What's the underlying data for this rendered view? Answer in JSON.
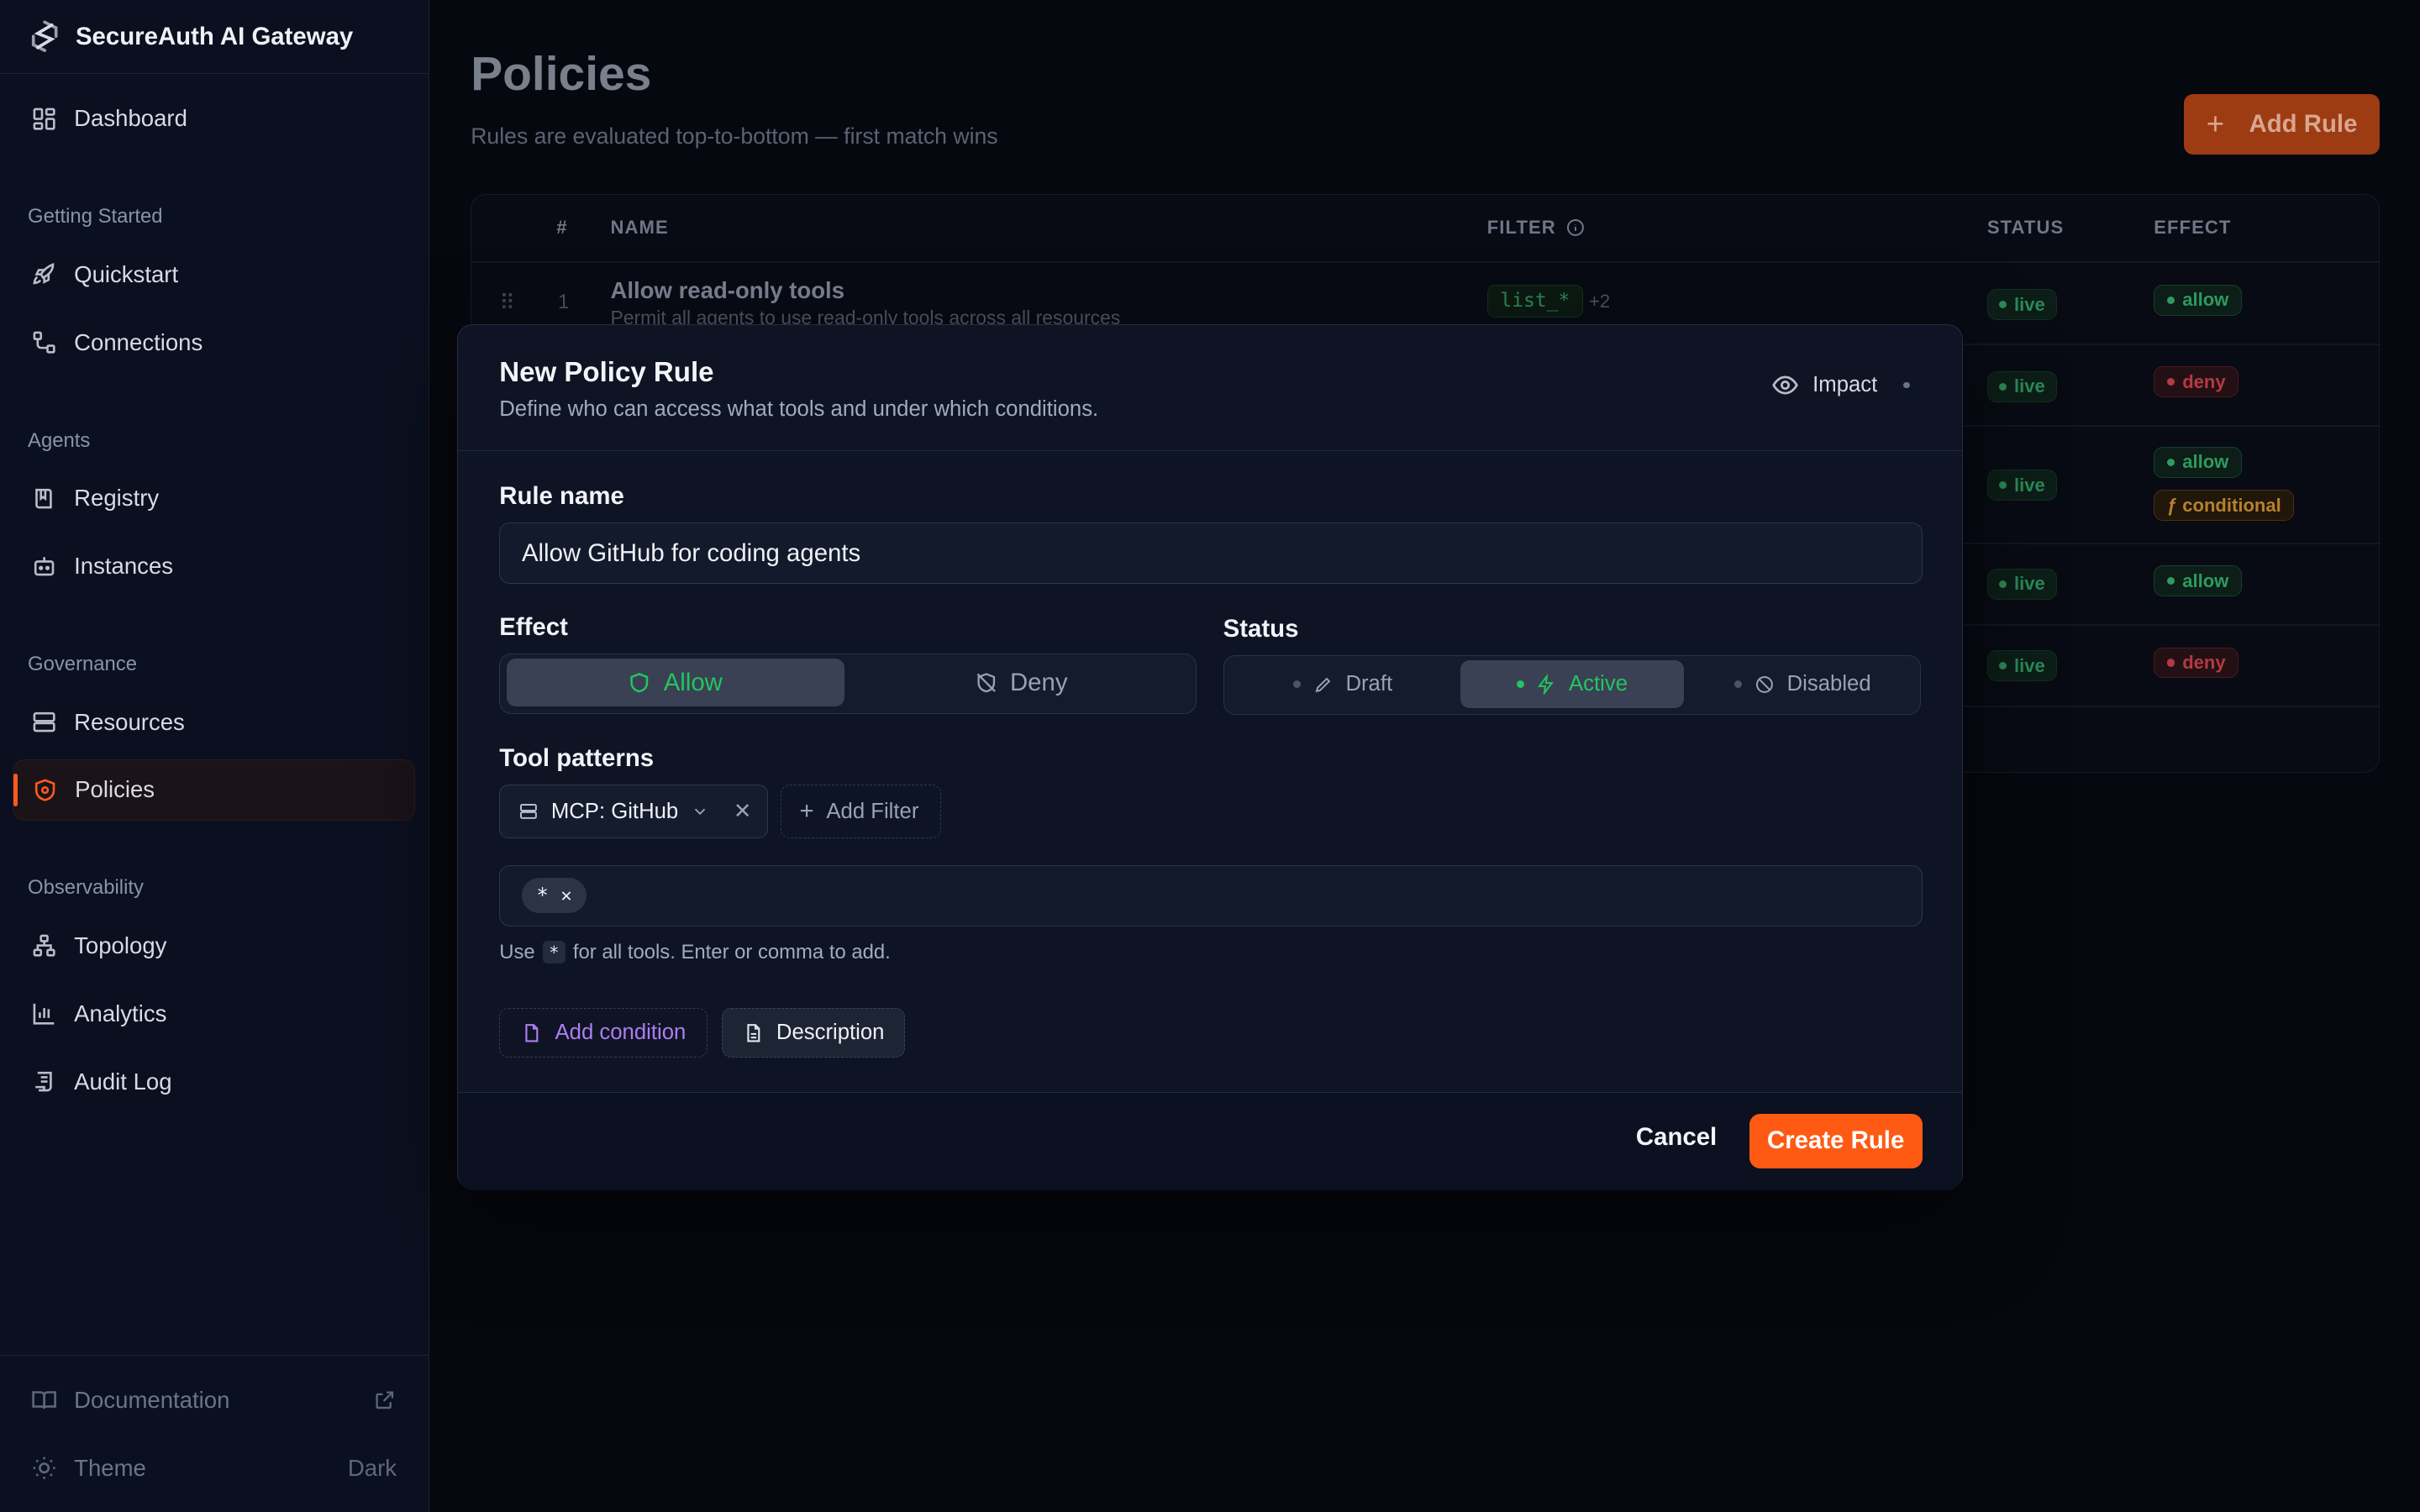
{
  "brand": {
    "name": "SecureAuth AI Gateway"
  },
  "sidebar": {
    "dashboard": "Dashboard",
    "groups": {
      "getting_started": "Getting Started",
      "agents": "Agents",
      "governance": "Governance",
      "observability": "Observability"
    },
    "items": {
      "quickstart": "Quickstart",
      "connections": "Connections",
      "registry": "Registry",
      "instances": "Instances",
      "resources": "Resources",
      "policies": "Policies",
      "topology": "Topology",
      "analytics": "Analytics",
      "audit_log": "Audit Log"
    },
    "bottom": {
      "documentation": "Documentation",
      "theme": "Theme",
      "theme_value": "Dark"
    }
  },
  "page": {
    "title": "Policies",
    "subtitle": "Rules are evaluated top-to-bottom — first match wins",
    "add_rule": "Add Rule"
  },
  "table": {
    "headers": {
      "num": "#",
      "name": "NAME",
      "filter": "FILTER",
      "status": "STATUS",
      "effect": "EFFECT"
    },
    "row1": {
      "num": "1",
      "name": "Allow read-only tools",
      "desc": "Permit all agents to use read-only tools across all resources",
      "filter": "list_*",
      "more": "+2"
    },
    "status_live": "live",
    "effects": [
      "allow",
      "deny",
      "allow",
      "allow",
      "deny"
    ],
    "conditional": "ƒ conditional"
  },
  "modal": {
    "title": "New Policy Rule",
    "description": "Define who can access what tools and under which conditions.",
    "impact": "Impact",
    "rule_name_label": "Rule name",
    "rule_name_value": "Allow GitHub for coding agents",
    "effect_label": "Effect",
    "effect_allow": "Allow",
    "effect_deny": "Deny",
    "status_label": "Status",
    "status_draft": "Draft",
    "status_active": "Active",
    "status_disabled": "Disabled",
    "tool_patterns_label": "Tool patterns",
    "filter_chip": "MCP: GitHub",
    "add_filter": "Add Filter",
    "pattern_tag": "*",
    "hint_use": "Use",
    "hint_code": "*",
    "hint_rest": "for all tools. Enter or comma to add.",
    "add_condition": "Add condition",
    "description_btn": "Description",
    "cancel": "Cancel",
    "create": "Create Rule"
  },
  "colors": {
    "accent": "#ff5a14",
    "allow": "#2ec27e",
    "deny": "#e5484d",
    "condition": "#b07cf0"
  }
}
